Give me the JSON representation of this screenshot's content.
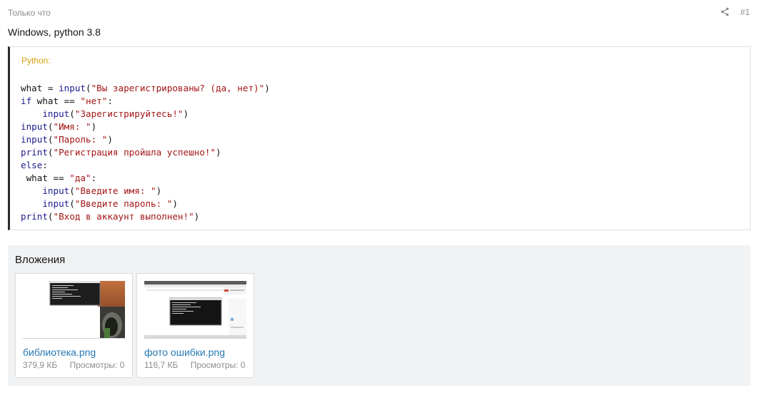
{
  "post": {
    "timestamp": "Только что",
    "number": "#1",
    "text": "Windows, python 3.8"
  },
  "code": {
    "language_label": "Python:",
    "lines": [
      [
        {
          "t": "plain",
          "v": "what = "
        },
        {
          "t": "kw",
          "v": "input"
        },
        {
          "t": "plain",
          "v": "("
        },
        {
          "t": "str",
          "v": "\"Вы зарегистрированы? (да, нет)\""
        },
        {
          "t": "plain",
          "v": ")"
        }
      ],
      [
        {
          "t": "kw",
          "v": "if"
        },
        {
          "t": "plain",
          "v": " what == "
        },
        {
          "t": "str",
          "v": "\"нет\""
        },
        {
          "t": "plain",
          "v": ":"
        }
      ],
      [
        {
          "t": "plain",
          "v": "    "
        },
        {
          "t": "kw",
          "v": "input"
        },
        {
          "t": "plain",
          "v": "("
        },
        {
          "t": "str",
          "v": "\"Зарегистрируйтесь!\""
        },
        {
          "t": "plain",
          "v": ")"
        }
      ],
      [
        {
          "t": "kw",
          "v": "input"
        },
        {
          "t": "plain",
          "v": "("
        },
        {
          "t": "str",
          "v": "\"Имя: \""
        },
        {
          "t": "plain",
          "v": ")"
        }
      ],
      [
        {
          "t": "kw",
          "v": "input"
        },
        {
          "t": "plain",
          "v": "("
        },
        {
          "t": "str",
          "v": "\"Пароль: \""
        },
        {
          "t": "plain",
          "v": ")"
        }
      ],
      [
        {
          "t": "kw",
          "v": "print"
        },
        {
          "t": "plain",
          "v": "("
        },
        {
          "t": "str",
          "v": "\"Регистрация пройшла успешно!\""
        },
        {
          "t": "plain",
          "v": ")"
        }
      ],
      [
        {
          "t": "kw",
          "v": "else"
        },
        {
          "t": "plain",
          "v": ":"
        }
      ],
      [
        {
          "t": "plain",
          "v": " what == "
        },
        {
          "t": "str",
          "v": "\"да\""
        },
        {
          "t": "plain",
          "v": ":"
        }
      ],
      [
        {
          "t": "plain",
          "v": "    "
        },
        {
          "t": "kw",
          "v": "input"
        },
        {
          "t": "plain",
          "v": "("
        },
        {
          "t": "str",
          "v": "\"Введите имя: \""
        },
        {
          "t": "plain",
          "v": ")"
        }
      ],
      [
        {
          "t": "plain",
          "v": "    "
        },
        {
          "t": "kw",
          "v": "input"
        },
        {
          "t": "plain",
          "v": "("
        },
        {
          "t": "str",
          "v": "\"Введите пароль: \""
        },
        {
          "t": "plain",
          "v": ")"
        }
      ],
      [
        {
          "t": "kw",
          "v": "print"
        },
        {
          "t": "plain",
          "v": "("
        },
        {
          "t": "str",
          "v": "\"Вход в аккаунт выполнен!\""
        },
        {
          "t": "plain",
          "v": ")"
        }
      ]
    ]
  },
  "attachments": {
    "title": "Вложения",
    "items": [
      {
        "name": "библиотека.png",
        "size": "379,9 КБ",
        "views": "Просмотры: 0"
      },
      {
        "name": "фото ошибки.png",
        "size": "116,7 КБ",
        "views": "Просмотры: 0"
      }
    ]
  },
  "icons": {
    "share": "share-icon"
  },
  "colors": {
    "link": "#2577b1",
    "language_label": "#d8a20e",
    "keyword": "#1b1b8a",
    "string": "#a31515",
    "muted": "#8c8c8c",
    "attachments_bg": "#f1f2f3"
  }
}
